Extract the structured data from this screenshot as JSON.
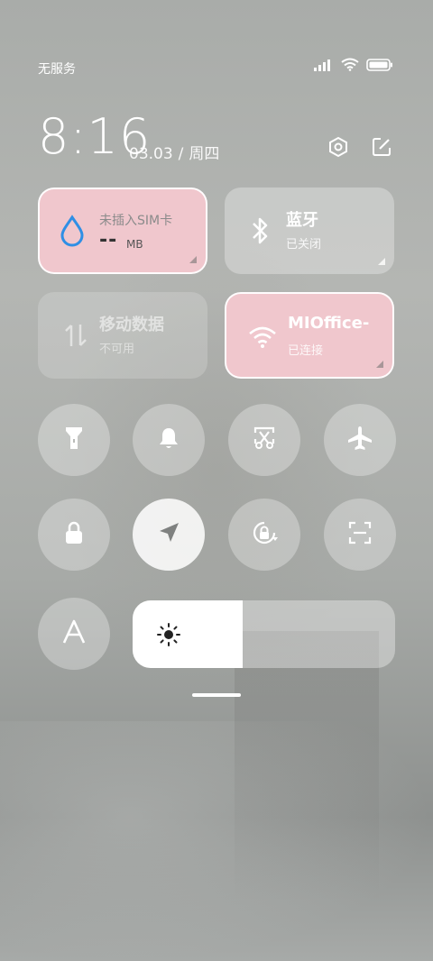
{
  "status": {
    "carrier": "无服务",
    "icons": [
      "signal-icon",
      "wifi-icon",
      "battery-icon"
    ]
  },
  "header": {
    "time": "8:16",
    "date": "03.03",
    "separator": "/",
    "weekday": "周四",
    "actions": [
      "settings-icon",
      "edit-icon"
    ]
  },
  "tiles": {
    "data_usage": {
      "label": "未插入SIM卡",
      "value": "--",
      "unit": "MB",
      "icon": "water-drop-icon"
    },
    "bluetooth": {
      "title": "蓝牙",
      "status": "已关闭",
      "icon": "bluetooth-icon"
    },
    "mobile_data": {
      "title": "移动数据",
      "status": "不可用",
      "icon": "data-arrows-icon"
    },
    "wifi": {
      "title": "MIOffice-",
      "status": "已连接",
      "icon": "wifi-icon"
    }
  },
  "toggles": [
    {
      "id": "flashlight",
      "icon": "flashlight-icon",
      "active": false
    },
    {
      "id": "ringer",
      "icon": "bell-icon",
      "active": false
    },
    {
      "id": "screenshot",
      "icon": "scissors-icon",
      "active": false
    },
    {
      "id": "airplane",
      "icon": "airplane-icon",
      "active": false
    },
    {
      "id": "lock",
      "icon": "lock-icon",
      "active": false
    },
    {
      "id": "location",
      "icon": "location-arrow-icon",
      "active": true
    },
    {
      "id": "rotation",
      "icon": "rotation-lock-icon",
      "active": false
    },
    {
      "id": "scanner",
      "icon": "scan-icon",
      "active": false
    },
    {
      "id": "auto_brightness",
      "icon": "font-a-icon",
      "active": false
    }
  ],
  "brightness": {
    "level": 0.42,
    "icon": "sun-icon"
  },
  "colors": {
    "accent_blue": "#2f8fe5",
    "tile_pink": "#f0c7cd"
  }
}
